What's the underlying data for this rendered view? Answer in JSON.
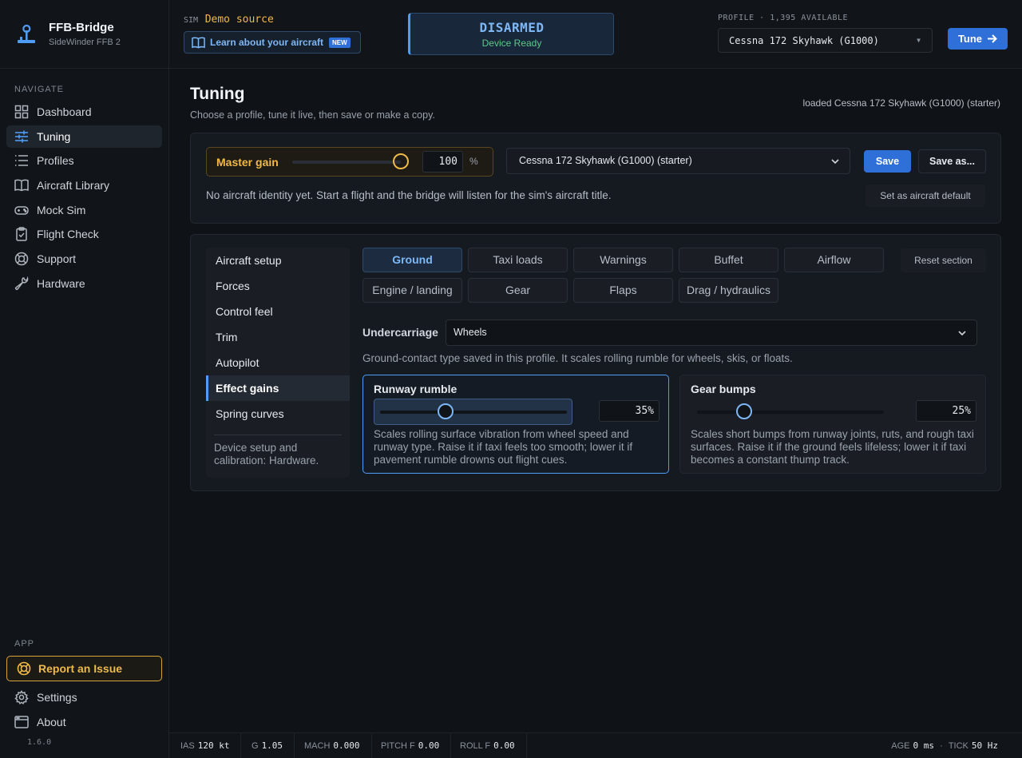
{
  "brand": {
    "title": "FFB-Bridge",
    "subtitle": "SideWinder FFB 2"
  },
  "nav": {
    "section_label": "NAVIGATE",
    "items": [
      {
        "label": "Dashboard",
        "icon": "dashboard-icon"
      },
      {
        "label": "Tuning",
        "icon": "sliders-icon",
        "active": true
      },
      {
        "label": "Profiles",
        "icon": "list-icon"
      },
      {
        "label": "Aircraft Library",
        "icon": "book-icon"
      },
      {
        "label": "Mock Sim",
        "icon": "gamepad-icon"
      },
      {
        "label": "Flight Check",
        "icon": "clipboard-check-icon"
      },
      {
        "label": "Support",
        "icon": "lifebuoy-icon"
      },
      {
        "label": "Hardware",
        "icon": "wrench-icon"
      }
    ]
  },
  "app": {
    "section_label": "APP",
    "report_label": "Report an Issue",
    "settings_label": "Settings",
    "about_label": "About",
    "version": "1.6.0"
  },
  "topbar": {
    "sim_tag": "SIM",
    "sim_source": "Demo source",
    "learn_label": "Learn about your aircraft",
    "new_badge": "NEW",
    "arm_state": "DISARMED",
    "arm_sub": "Device Ready",
    "profile_label": "PROFILE · 1,395 AVAILABLE",
    "profile_value": "Cessna 172 Skyhawk (G1000)",
    "tune_label": "Tune"
  },
  "page": {
    "title": "Tuning",
    "subtitle": "Choose a profile, tune it live, then save or make a copy.",
    "loaded": "loaded Cessna 172 Skyhawk (G1000) (starter)"
  },
  "master": {
    "label": "Master gain",
    "value": "100",
    "unit": "%",
    "level": 1.0,
    "profile_select": "Cessna 172 Skyhawk (G1000) (starter)",
    "save_label": "Save",
    "save_as_label": "Save as...",
    "identity_text": "No aircraft identity yet. Start a flight and the bridge will listen for the sim's aircraft title.",
    "default_label": "Set as aircraft default"
  },
  "sections": {
    "items": [
      "Aircraft setup",
      "Forces",
      "Control feel",
      "Trim",
      "Autopilot",
      "Effect gains",
      "Spring curves"
    ],
    "active_index": 5,
    "note": "Device setup and calibration: Hardware."
  },
  "tabs": {
    "row1": [
      "Ground",
      "Taxi loads",
      "Warnings",
      "Buffet",
      "Airflow"
    ],
    "row2": [
      "Engine / landing",
      "Gear",
      "Flaps",
      "Drag / hydraulics"
    ],
    "active": "Ground",
    "reset_label": "Reset section"
  },
  "undercarriage": {
    "label": "Undercarriage",
    "value": "Wheels",
    "hint": "Ground-contact type saved in this profile. It scales rolling rumble for wheels, skis, or floats."
  },
  "effects": [
    {
      "title": "Runway rumble",
      "value": "35%",
      "level": 0.35,
      "description": "Scales rolling surface vibration from wheel speed and runway type. Raise it if taxi feels too smooth; lower it if pavement rumble drowns out flight cues."
    },
    {
      "title": "Gear bumps",
      "value": "25%",
      "level": 0.25,
      "description": "Scales short bumps from runway joints, ruts, and rough taxi surfaces. Raise it if the ground feels lifeless; lower it if taxi becomes a constant thump track."
    }
  ],
  "status": {
    "ias_label": "IAS",
    "ias_value": "120 kt",
    "g_label": "G",
    "g_value": "1.05",
    "mach_label": "MACH",
    "mach_value": "0.000",
    "pitch_label": "PITCH F",
    "pitch_value": "0.00",
    "roll_label": "ROLL F",
    "roll_value": "0.00",
    "age_label": "AGE",
    "age_value": "0 ms",
    "tick_label": "TICK",
    "tick_value": "50 Hz"
  },
  "colors": {
    "accent": "#2f6fd8",
    "warning": "#f0b94a",
    "ok": "#5cc98a"
  }
}
